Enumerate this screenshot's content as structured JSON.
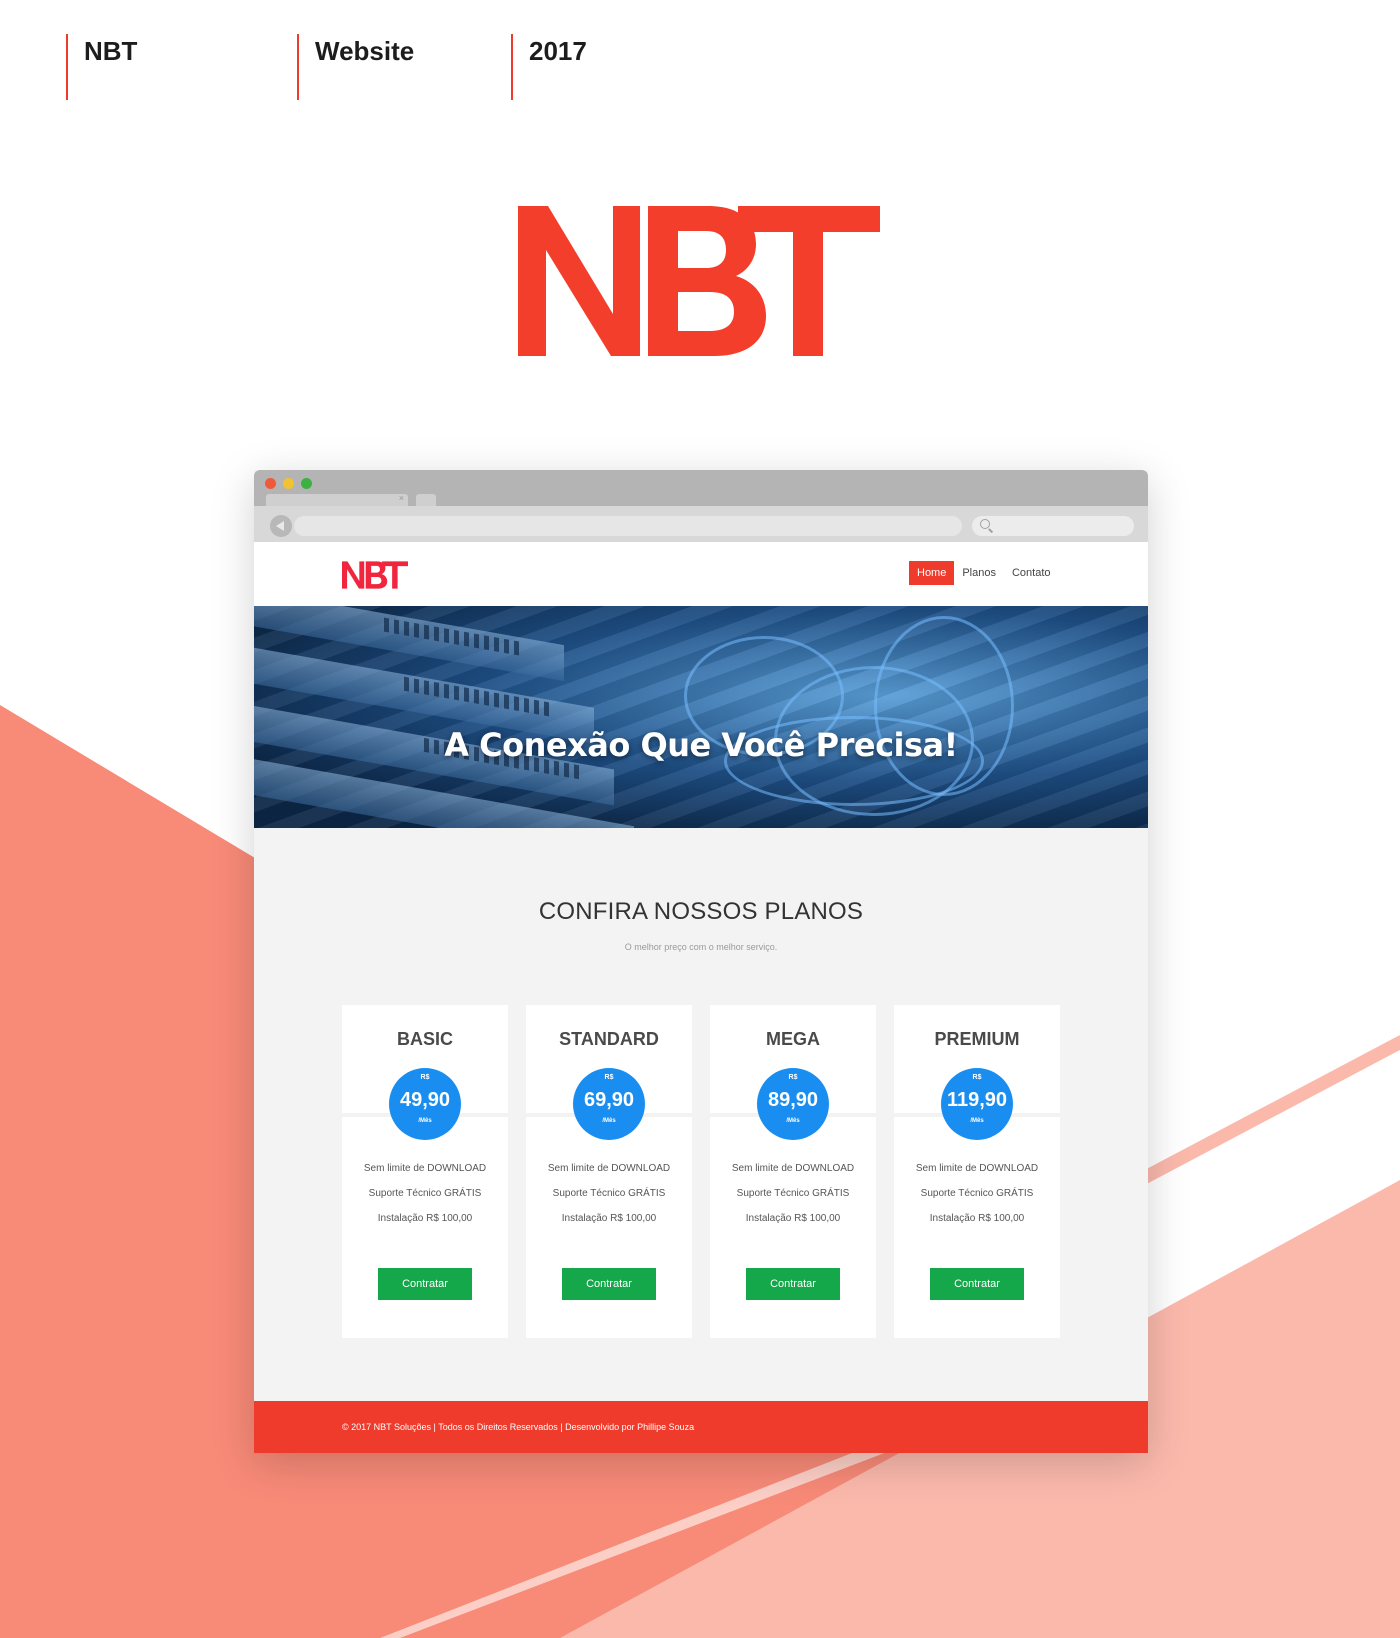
{
  "meta": {
    "client": "NBT",
    "category": "Website",
    "year": "2017"
  },
  "colors": {
    "brand_red": "#ee3b2b",
    "price_blue": "#1a8ef0",
    "button_green": "#14a84a",
    "bg_salmon": "#f88a78",
    "bg_pink": "#fbb9ac"
  },
  "logo_text": "NBT",
  "site": {
    "logo_text": "NBT",
    "nav": [
      {
        "label": "Home",
        "active": true
      },
      {
        "label": "Planos",
        "active": false
      },
      {
        "label": "Contato",
        "active": false
      }
    ],
    "hero_title": "A Conexão Que Você Precisa!",
    "plans_title": "CONFIRA NOSSOS PLANOS",
    "plans_subtitle": "O melhor preço com o melhor serviço.",
    "plans": [
      {
        "name": "BASIC",
        "currency": "R$",
        "price": "49,90",
        "period": "/Mês",
        "features": [
          "Sem limite de DOWNLOAD",
          "Suporte Técnico GRÁTIS",
          "Instalação R$ 100,00"
        ],
        "button": "Contratar"
      },
      {
        "name": "STANDARD",
        "currency": "R$",
        "price": "69,90",
        "period": "/Mês",
        "features": [
          "Sem limite de DOWNLOAD",
          "Suporte Técnico GRÁTIS",
          "Instalação R$ 100,00"
        ],
        "button": "Contratar"
      },
      {
        "name": "MEGA",
        "currency": "R$",
        "price": "89,90",
        "period": "/Mês",
        "features": [
          "Sem limite de DOWNLOAD",
          "Suporte Técnico GRÁTIS",
          "Instalação R$ 100,00"
        ],
        "button": "Contratar"
      },
      {
        "name": "PREMIUM",
        "currency": "R$",
        "price": "119,90",
        "period": "/Mês",
        "features": [
          "Sem limite de DOWNLOAD",
          "Suporte Técnico GRÁTIS",
          "Instalação R$ 100,00"
        ],
        "button": "Contratar"
      }
    ],
    "footer": "© 2017 NBT Soluções  |  Todos os Direitos Reservados  |  Desenvolvido por Phillipe Souza"
  }
}
